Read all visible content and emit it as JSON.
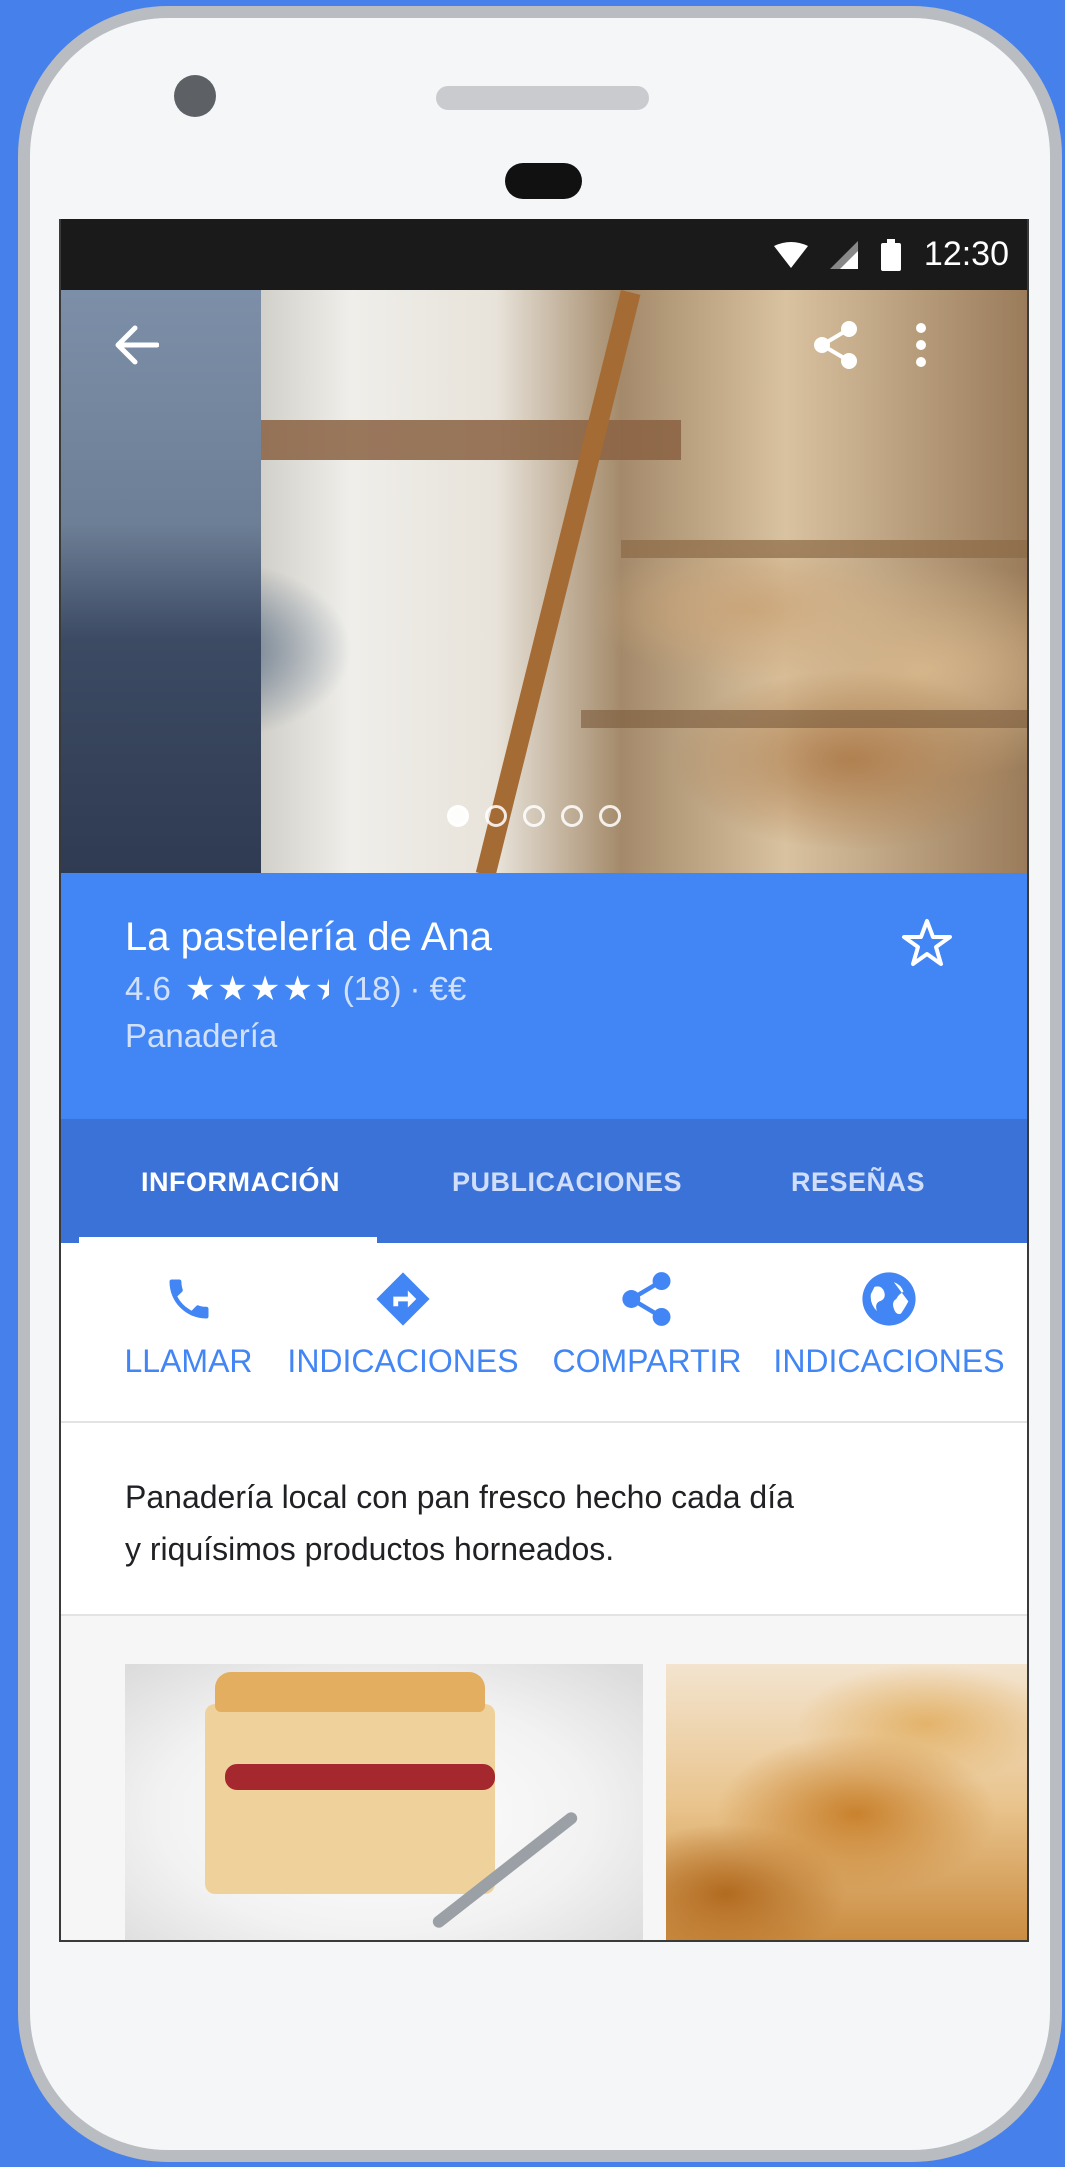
{
  "statusbar": {
    "time": "12:30"
  },
  "place": {
    "name": "La pastelería de Ana",
    "rating": "4.6",
    "stars": "★★★★",
    "reviews_count": "(18)",
    "price": "· €€",
    "category": "Panadería"
  },
  "tabs": [
    {
      "label": "INFORMACIÓN",
      "active": true
    },
    {
      "label": "PUBLICACIONES",
      "active": false
    },
    {
      "label": "RESEÑAS",
      "active": false
    }
  ],
  "actions": [
    {
      "label": "LLAMAR",
      "icon": "phone-icon"
    },
    {
      "label": "INDICACIONES",
      "icon": "directions-icon"
    },
    {
      "label": "COMPARTIR",
      "icon": "share-icon"
    },
    {
      "label": "INDICACIONES",
      "icon": "globe-icon"
    }
  ],
  "description": {
    "line1": "Panadería local con pan fresco hecho cada día",
    "line2": "y riquísimos productos horneados."
  },
  "colors": {
    "accent": "#4285f4",
    "tab_bar": "#3a72d8",
    "background": "#4580eb"
  }
}
